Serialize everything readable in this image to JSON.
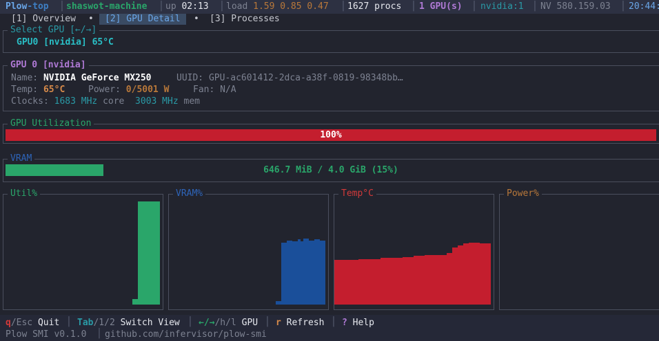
{
  "topbar": {
    "app_name_a": "Plow",
    "app_name_b": "-top",
    "host": "shaswot-machine",
    "uptime_label": "up",
    "uptime": "02:13",
    "load_label": "load",
    "load": "1.59 0.85 0.47",
    "procs": "1627 procs",
    "gpus": "1 GPU(s)",
    "vendor": "nvidia:1",
    "driver": "NV 580.159.03",
    "clock": "20:44:"
  },
  "tabs": [
    {
      "label": "[1] Overview"
    },
    {
      "label": "[2] GPU Detail"
    },
    {
      "label": "[3] Processes"
    }
  ],
  "select_gpu": {
    "title": "Select GPU [←/→]",
    "selected": "GPU0 [nvidia] 65°C"
  },
  "gpu_info": {
    "title": "GPU 0 [nvidia]",
    "name_label": "Name:",
    "name": "NVIDIA GeForce MX250",
    "uuid": "UUID: GPU-ac601412-2dca-a38f-0819-98348bb…",
    "temp_label": "Temp:",
    "temp": "65°C",
    "power_label": "Power:",
    "power": "0/5001 W",
    "fan": "Fan: N/A",
    "clocks_label": "Clocks:",
    "core_clock": "1683 MHz",
    "core_label": "core",
    "mem_clock": "3003 MHz",
    "mem_label": "mem"
  },
  "utilization": {
    "title": "GPU Utilization",
    "value": 1.0,
    "label": "100%"
  },
  "vram": {
    "title": "VRAM",
    "fraction": 0.15,
    "label": "646.7 MiB / 4.0 GiB (15%)"
  },
  "graphs": [
    {
      "title": "Util%",
      "color": "#2aa66a",
      "title_color": "#2aa66a",
      "values": [
        0,
        0,
        0,
        0,
        0,
        0,
        0,
        0,
        0,
        0,
        0,
        0,
        0,
        0,
        0,
        0,
        0,
        0,
        0,
        0,
        0,
        0,
        0,
        0,
        0,
        0,
        0,
        0,
        0,
        0,
        5,
        5,
        100,
        100,
        100,
        100,
        100,
        100,
        100,
        100
      ]
    },
    {
      "title": "VRAM%",
      "color": "#1a4f9a",
      "title_color": "#2e64b8",
      "values": [
        0,
        0,
        0,
        0,
        0,
        0,
        0,
        0,
        0,
        0,
        0,
        0,
        0,
        0,
        0,
        0,
        0,
        0,
        0,
        0,
        0,
        0,
        0,
        0,
        0,
        0,
        0,
        0,
        0,
        0,
        3,
        3,
        60,
        60,
        62,
        62,
        61,
        61,
        63,
        61,
        64,
        64,
        62,
        62,
        63,
        63,
        62,
        62
      ]
    },
    {
      "title": "Temp°C",
      "color": "#c41e2e",
      "title_color": "#d23a3a",
      "values": [
        43,
        43,
        43,
        43,
        43,
        43,
        43,
        43,
        43,
        43,
        43,
        43,
        43,
        43,
        43,
        43,
        44,
        44,
        44,
        44,
        44,
        44,
        44,
        44,
        45,
        45,
        45,
        45,
        45,
        45,
        45,
        45,
        46,
        46,
        46,
        46,
        47,
        47,
        47,
        47,
        48,
        48,
        48,
        48,
        48,
        48,
        48,
        48,
        50,
        50,
        55,
        55,
        57,
        57,
        59,
        59,
        60,
        60,
        60,
        60,
        59,
        59,
        59,
        59
      ]
    },
    {
      "title": "Power%",
      "color": "#b8783a",
      "title_color": "#b8783a",
      "values": []
    }
  ],
  "footer": {
    "keys": [
      {
        "key": "q",
        "rest": "/Esc",
        "action": "Quit"
      },
      {
        "key": "Tab",
        "rest": "/1/2",
        "action": "Switch View"
      },
      {
        "key": "←/→",
        "rest": "/h/l",
        "action": "GPU"
      },
      {
        "key": "r",
        "rest": "",
        "action": "Refresh"
      },
      {
        "key": "?",
        "rest": "",
        "action": "Help"
      }
    ],
    "version": "Plow SMI v0.1.0",
    "repo": "github.com/infervisor/plow-smi"
  }
}
